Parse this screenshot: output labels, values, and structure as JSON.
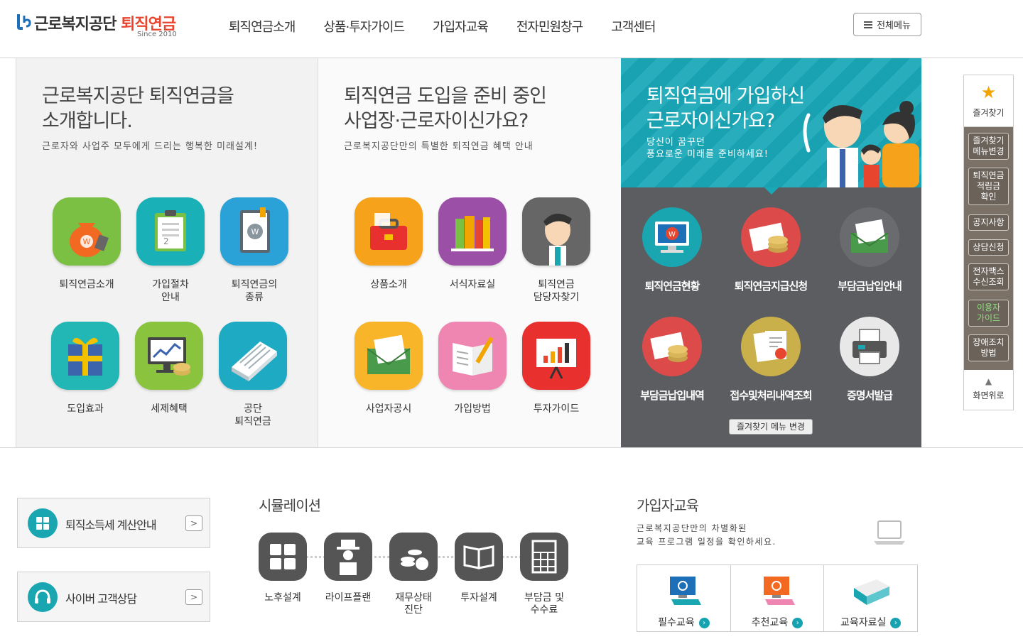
{
  "header": {
    "logo_prefix": "근로복지공단",
    "logo_highlight": "퇴직연금",
    "logo_since": "Since 2010",
    "nav": [
      "퇴직연금소개",
      "상품·투자가이드",
      "가입자교육",
      "전자민원창구",
      "고객센터"
    ],
    "all_menu": "전체메뉴"
  },
  "panel1": {
    "title_line1": "근로복지공단 퇴직연금을",
    "title_line2": "소개합니다.",
    "subtitle": "근로자와 사업주 모두에게 드리는 행복한 미래설계!",
    "items": [
      "퇴직연금소개",
      "가입절차\n안내",
      "퇴직연금의\n종류",
      "도입효과",
      "세제혜택",
      "공단\n퇴직연금"
    ]
  },
  "panel2": {
    "title_line1": "퇴직연금 도입을 준비 중인",
    "title_line2": "사업장·근로자이신가요?",
    "subtitle": "근로복지공단만의 특별한 퇴직연금 혜택 안내",
    "items": [
      "상품소개",
      "서식자료실",
      "퇴직연금\n담당자찾기",
      "사업자공시",
      "가입방법",
      "투자가이드"
    ]
  },
  "panel3": {
    "title_line1": "퇴직연금에 가입하신",
    "title_line2": "근로자이신가요?",
    "subtitle": "당신이 꿈꾸던\n풍요로운 미래를 준비하세요!",
    "items": [
      "퇴직연금현황",
      "퇴직연금지급신청",
      "부담금납입안내",
      "부담금납입내역",
      "접수및처리내역조회",
      "증명서발급"
    ],
    "fav_change": "즐겨찾기 메뉴 변경"
  },
  "quick": {
    "fav": "즐겨찾기",
    "buttons": [
      "즐겨찾기\n메뉴변경",
      "퇴직연금\n적립금\n확인",
      "공지사항",
      "상담신청",
      "전자팩스\n수신조회",
      "이용자\n가이드",
      "장애조치\n방법"
    ],
    "top": "화면위로"
  },
  "bottom": {
    "buttons": [
      "퇴직소득세 계산안내",
      "사이버 고객상담"
    ],
    "simulation_title": "시뮬레이션",
    "simulation_items": [
      "노후설계",
      "라이프플랜",
      "재무상태\n진단",
      "투자설계",
      "부담금 및\n수수료"
    ],
    "edu_title": "가입자교육",
    "edu_desc": "근로복지공단만의 차별화된\n교육 프로그램 일정을 확인하세요.",
    "edu_items": [
      "필수교육",
      "추천교육",
      "교육자료실"
    ]
  },
  "colors": {
    "accent": "#1aa8b8",
    "brand_red": "#e8452f",
    "panel_dark": "#5c5d61"
  }
}
